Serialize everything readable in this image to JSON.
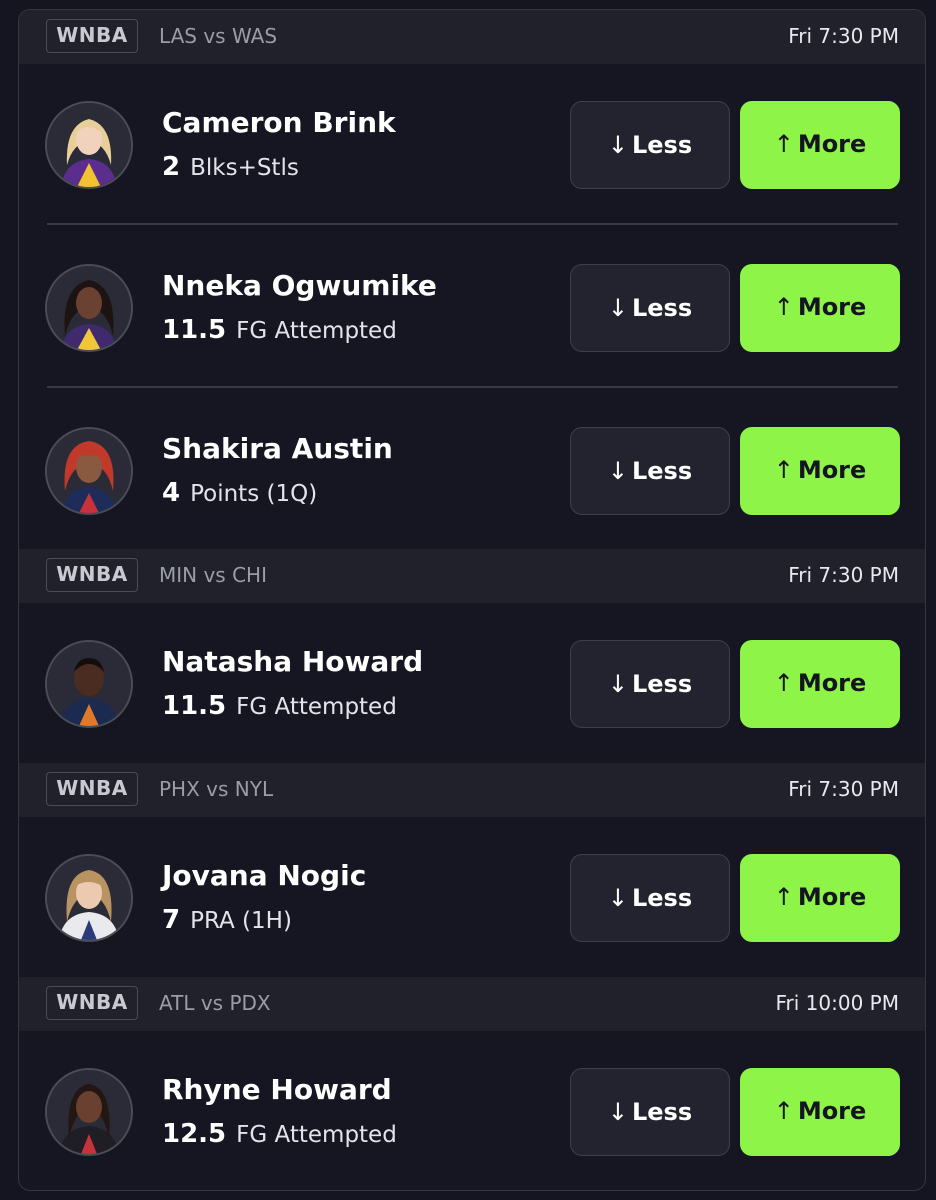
{
  "games": [
    {
      "league": "WNBA",
      "matchup": "LAS vs WAS",
      "time": "Fri 7:30 PM",
      "players": [
        {
          "name": "Cameron Brink",
          "value": "2",
          "stat": "Blks+Stls"
        },
        {
          "name": "Nneka Ogwumike",
          "value": "11.5",
          "stat": "FG Attempted"
        },
        {
          "name": "Shakira Austin",
          "value": "4",
          "stat": "Points (1Q)"
        }
      ]
    },
    {
      "league": "WNBA",
      "matchup": "MIN vs CHI",
      "time": "Fri 7:30 PM",
      "players": [
        {
          "name": "Natasha Howard",
          "value": "11.5",
          "stat": "FG Attempted"
        }
      ]
    },
    {
      "league": "WNBA",
      "matchup": "PHX vs NYL",
      "time": "Fri 7:30 PM",
      "players": [
        {
          "name": "Jovana Nogic",
          "value": "7",
          "stat": "PRA (1H)"
        }
      ]
    },
    {
      "league": "WNBA",
      "matchup": "ATL vs PDX",
      "time": "Fri 10:00 PM",
      "players": [
        {
          "name": "Rhyne Howard",
          "value": "12.5",
          "stat": "FG Attempted"
        }
      ]
    }
  ],
  "buttons": {
    "less_label": "Less",
    "more_label": "More",
    "less_arrow": "↓",
    "more_arrow": "↑"
  },
  "colors": {
    "accent": "#8ff448",
    "background": "#151621",
    "header_bg": "#20212b"
  }
}
